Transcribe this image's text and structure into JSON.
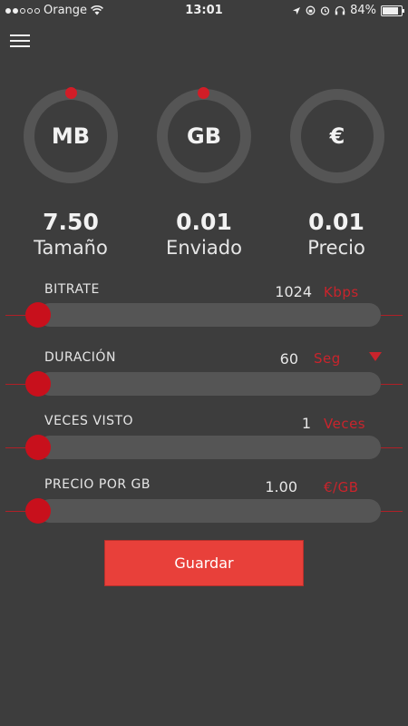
{
  "status_bar": {
    "carrier": "Orange",
    "time": "13:01",
    "battery": "84%",
    "battery_level": 0.84
  },
  "summary": [
    {
      "unit_label": "MB",
      "value": "7.50",
      "caption": "Tamaño"
    },
    {
      "unit_label": "GB",
      "value": "0.01",
      "caption": "Enviado"
    },
    {
      "unit_label": "€",
      "value": "0.01",
      "caption": "Precio"
    }
  ],
  "params": [
    {
      "label": "BITRATE",
      "value": "1024",
      "unit": "Kbps",
      "level": 0
    },
    {
      "label": "DURACIÓN",
      "value": "60",
      "unit": "Seg",
      "level": 0
    },
    {
      "label": "VECES VISTO",
      "value": "1",
      "unit": "Veces",
      "level": 0
    },
    {
      "label": "PRECIO POR GB",
      "value": "1.00",
      "unit": "€/GB",
      "level": 0
    }
  ],
  "save_label": "Guardar",
  "colors": {
    "background": "#3d3d3d",
    "accent": "#d21d27",
    "button": "#e8403a",
    "track": "#555555"
  },
  "icons": {
    "menu": "hamburger-menu-icon",
    "wifi": "wifi-icon",
    "lock": "rotation-lock-icon",
    "location": "location-arrow-icon",
    "alarm": "alarm-clock-icon",
    "headphones": "headphones-icon",
    "battery": "battery-icon",
    "dropdown": "triangle-down-icon"
  }
}
